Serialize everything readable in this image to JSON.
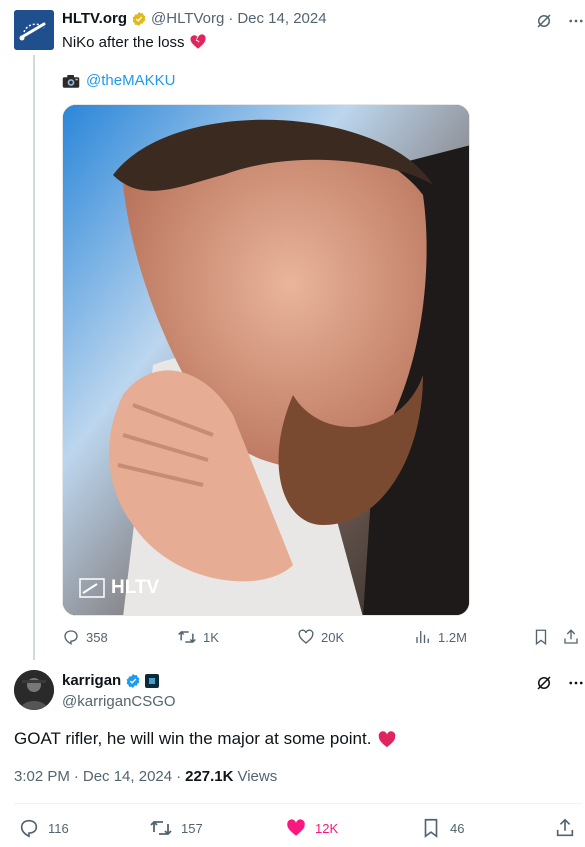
{
  "parent": {
    "name": "HLTV.org",
    "handle": "@HLTVorg",
    "separator": "·",
    "date": "Dec 14, 2024",
    "text": "NiKo after the loss",
    "photo_credit": "@theMAKKU",
    "photo_watermark": "HLTV",
    "stats": {
      "replies": "358",
      "reposts": "1K",
      "likes": "20K",
      "views": "1.2M"
    }
  },
  "reply": {
    "name": "karrigan",
    "handle": "@karriganCSGO",
    "text": "GOAT rifler, he will win the major at some point.",
    "time": "3:02 PM",
    "separator": "·",
    "date": "Dec 14, 2024",
    "views_count": "227.1K",
    "views_label": "Views",
    "stats": {
      "replies": "116",
      "reposts": "157",
      "likes": "12K",
      "bookmarks": "46"
    }
  },
  "colors": {
    "accent": "#1d9bf0",
    "like_active": "#f91880",
    "verified_gold": "#e2b719",
    "heart": "#e0245e"
  },
  "icons": [
    "grok-icon",
    "more-icon",
    "reply-icon",
    "repost-icon",
    "like-icon",
    "views-icon",
    "bookmark-icon",
    "share-icon",
    "camera-icon",
    "broken-heart-icon",
    "red-heart-icon",
    "verified-badge-icon"
  ]
}
